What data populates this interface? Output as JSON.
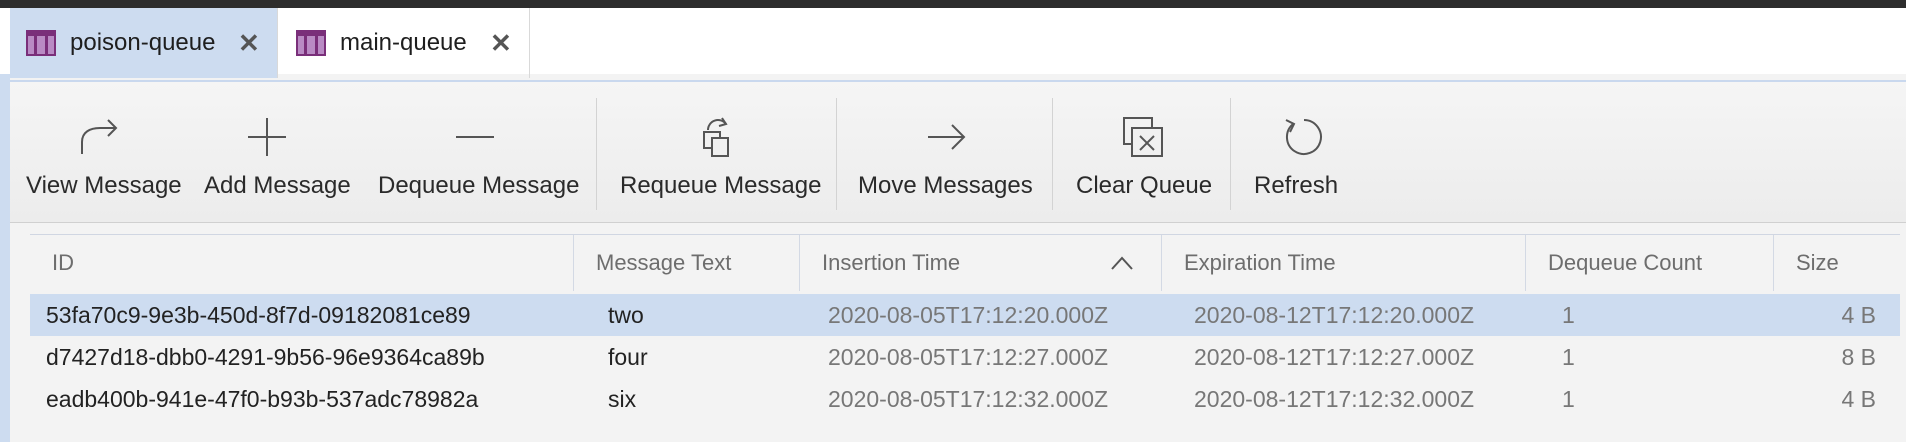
{
  "tabs": [
    {
      "label": "poison-queue",
      "active": true
    },
    {
      "label": "main-queue",
      "active": false
    }
  ],
  "toolbar": {
    "view_message": "View Message",
    "add_message": "Add Message",
    "dequeue_message": "Dequeue Message",
    "requeue_message": "Requeue Message",
    "move_messages": "Move Messages",
    "clear_queue": "Clear Queue",
    "refresh": "Refresh"
  },
  "grid": {
    "columns": [
      "ID",
      "Message Text",
      "Insertion Time",
      "Expiration Time",
      "Dequeue Count",
      "Size"
    ],
    "sort_column": "Insertion Time",
    "sort_direction": "ascending",
    "rows": [
      {
        "id": "53fa70c9-9e3b-450d-8f7d-09182081ce89",
        "text": "two",
        "insertion": "2020-08-05T17:12:20.000Z",
        "expiration": "2020-08-12T17:12:20.000Z",
        "count": "1",
        "size": "4 B",
        "selected": true
      },
      {
        "id": "d7427d18-dbb0-4291-9b56-96e9364ca89b",
        "text": "four",
        "insertion": "2020-08-05T17:12:27.000Z",
        "expiration": "2020-08-12T17:12:27.000Z",
        "count": "1",
        "size": "8 B",
        "selected": false
      },
      {
        "id": "eadb400b-941e-47f0-b93b-537adc78982a",
        "text": "six",
        "insertion": "2020-08-05T17:12:32.000Z",
        "expiration": "2020-08-12T17:12:32.000Z",
        "count": "1",
        "size": "4 B",
        "selected": false
      }
    ]
  },
  "colors": {
    "accent": "#cddcf0",
    "queue_icon": "#7a2f7a"
  }
}
